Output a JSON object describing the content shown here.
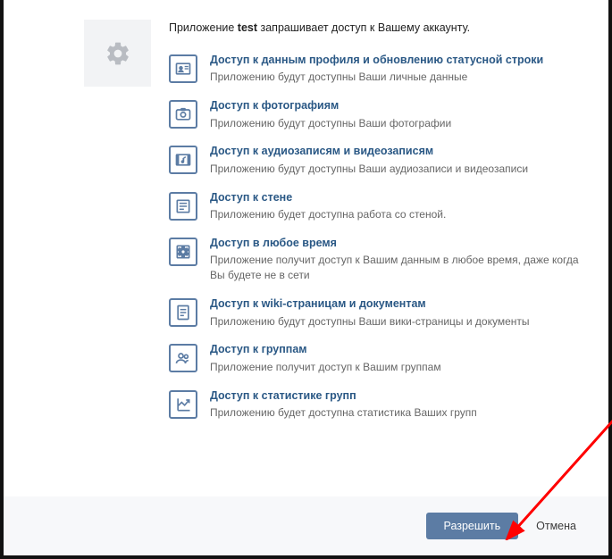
{
  "intro": {
    "prefix": "Приложение ",
    "app_name": "test",
    "suffix": " запрашивает доступ к Вашему аккаунту."
  },
  "permissions": [
    {
      "icon": "profile-icon",
      "title": "Доступ к данным профиля и обновлению статусной строки",
      "desc": "Приложению будут доступны Ваши личные данные"
    },
    {
      "icon": "photos-icon",
      "title": "Доступ к фотографиям",
      "desc": "Приложению будут доступны Ваши фотографии"
    },
    {
      "icon": "audio-video-icon",
      "title": "Доступ к аудиозаписям и видеозаписям",
      "desc": "Приложению будут доступны Ваши аудиозаписи и видеозаписи"
    },
    {
      "icon": "wall-icon",
      "title": "Доступ к стене",
      "desc": "Приложению будет доступна работа со стеной."
    },
    {
      "icon": "offline-icon",
      "title": "Доступ в любое время",
      "desc": "Приложение получит доступ к Вашим данным в любое время, даже когда Вы будете не в сети"
    },
    {
      "icon": "wiki-docs-icon",
      "title": "Доступ к wiki-страницам и документам",
      "desc": "Приложению будут доступны Ваши вики-страницы и документы"
    },
    {
      "icon": "groups-icon",
      "title": "Доступ к группам",
      "desc": "Приложение получит доступ к Вашим группам"
    },
    {
      "icon": "stats-icon",
      "title": "Доступ к статистике групп",
      "desc": "Приложению будет доступна статистика Ваших групп"
    }
  ],
  "buttons": {
    "allow": "Разрешить",
    "cancel": "Отмена"
  }
}
